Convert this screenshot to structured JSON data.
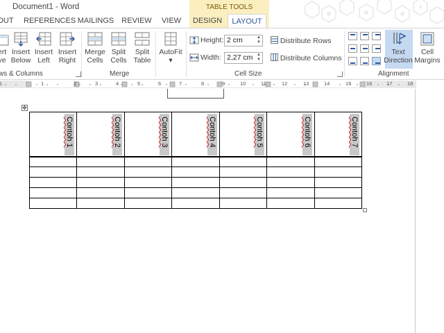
{
  "titlebar": {
    "title": "Document1 - Word",
    "table_tools": "TABLE TOOLS"
  },
  "tabs": [
    {
      "label": "OUT",
      "active": false
    },
    {
      "label": "REFERENCES",
      "active": false
    },
    {
      "label": "MAILINGS",
      "active": false
    },
    {
      "label": "REVIEW",
      "active": false
    },
    {
      "label": "VIEW",
      "active": false
    },
    {
      "label": "DESIGN",
      "active": false
    },
    {
      "label": "LAYOUT",
      "active": true
    }
  ],
  "ribbon": {
    "rows_columns": {
      "group_label": "ws & Columns",
      "buttons": [
        {
          "l1": "ert",
          "l2": "ve"
        },
        {
          "l1": "Insert",
          "l2": "Below"
        },
        {
          "l1": "Insert",
          "l2": "Left"
        },
        {
          "l1": "Insert",
          "l2": "Right"
        }
      ]
    },
    "merge": {
      "group_label": "Merge",
      "buttons": [
        {
          "l1": "Merge",
          "l2": "Cells"
        },
        {
          "l1": "Split",
          "l2": "Cells"
        },
        {
          "l1": "Split",
          "l2": "Table"
        }
      ]
    },
    "autofit": {
      "label": "AutoFit",
      "caret": "▾"
    },
    "cell_size": {
      "group_label": "Cell Size",
      "height_label": "Height:",
      "height_value": "2 cm",
      "width_label": "Width:",
      "width_value": "2,27 cm",
      "distribute_rows": "Distribute Rows",
      "distribute_columns": "Distribute Columns"
    },
    "alignment": {
      "group_label": "Alignment",
      "text_direction": {
        "l1": "Text",
        "l2": "Direction"
      },
      "cell_margins": {
        "l1": "Cell",
        "l2": "Margins"
      }
    }
  },
  "ruler": {
    "numbers": [
      "1",
      "1",
      "2",
      "3",
      "4",
      "5",
      "6",
      "7",
      "8",
      "9",
      "10",
      "11",
      "12",
      "13",
      "14",
      "15",
      "16",
      "17",
      "18"
    ]
  },
  "table": {
    "headers": [
      "Contoh 1",
      "Contoh 2",
      "Contoh 3",
      "Contoh 4",
      "Contoh 5",
      "Contoh 6",
      "Contoh 7"
    ],
    "empty_rows": 5
  },
  "icons": {
    "move_handle": "move-icon",
    "resize_handle": "resize-icon"
  }
}
